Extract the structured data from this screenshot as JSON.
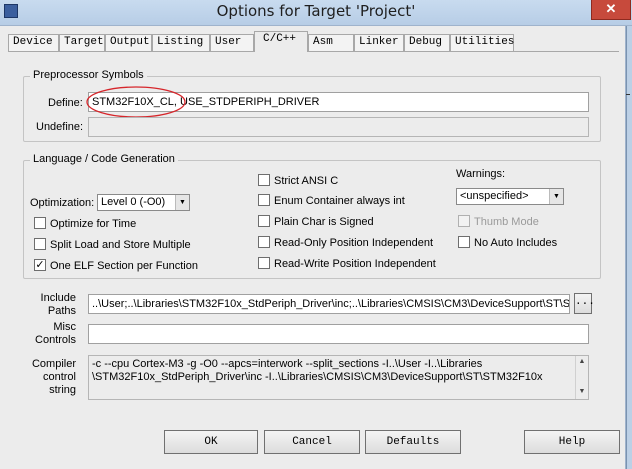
{
  "window": {
    "title": "Options for Target 'Project'",
    "close_glyph": "✕"
  },
  "tabs": [
    "Device",
    "Target",
    "Output",
    "Listing",
    "User",
    "C/C++",
    "Asm",
    "Linker",
    "Debug",
    "Utilities"
  ],
  "active_tab": "C/C++",
  "preprocessor": {
    "title": "Preprocessor Symbols",
    "define_label": "Define:",
    "define_value": "STM32F10X_CL, USE_STDPERIPH_DRIVER",
    "undefine_label": "Undefine:",
    "undefine_value": "",
    "highlight_color": "#d6262b"
  },
  "language": {
    "title": "Language / Code Generation",
    "optimization_label": "Optimization:",
    "optimization_value": "Level 0 (-O0)",
    "checkboxes": {
      "optimize_time": {
        "label": "Optimize for Time",
        "checked": false
      },
      "split_load": {
        "label": "Split Load and Store Multiple",
        "checked": false
      },
      "one_elf": {
        "label": "One ELF Section per Function",
        "checked": true
      },
      "strict_ansi": {
        "label": "Strict ANSI C",
        "checked": false
      },
      "enum_int": {
        "label": "Enum Container always int",
        "checked": false
      },
      "plain_char": {
        "label": "Plain Char is Signed",
        "checked": false
      },
      "ro_pi": {
        "label": "Read-Only Position Independent",
        "checked": false
      },
      "rw_pi": {
        "label": "Read-Write Position Independent",
        "checked": false
      },
      "thumb_mode": {
        "label": "Thumb Mode",
        "checked": false,
        "disabled": true
      },
      "no_auto_includes": {
        "label": "No Auto Includes",
        "checked": false
      }
    },
    "warnings_label": "Warnings:",
    "warnings_value": "<unspecified>"
  },
  "include_paths": {
    "label_line1": "Include",
    "label_line2": "Paths",
    "value": "..\\User;..\\Libraries\\STM32F10x_StdPeriph_Driver\\inc;..\\Libraries\\CMSIS\\CM3\\DeviceSupport\\ST\\S",
    "browse_label": "..."
  },
  "misc_controls": {
    "label_line1": "Misc",
    "label_line2": "Controls",
    "value": ""
  },
  "compiler_control": {
    "label_line1": "Compiler",
    "label_line2": "control",
    "label_line3": "string",
    "line1": "-c --cpu Cortex-M3 -g -O0 --apcs=interwork --split_sections -I..\\User -I..\\Libraries",
    "line2": "\\STM32F10x_StdPeriph_Driver\\inc -I..\\Libraries\\CMSIS\\CM3\\DeviceSupport\\ST\\STM32F10x"
  },
  "buttons": {
    "ok": "OK",
    "cancel": "Cancel",
    "defaults": "Defaults",
    "help": "Help"
  }
}
